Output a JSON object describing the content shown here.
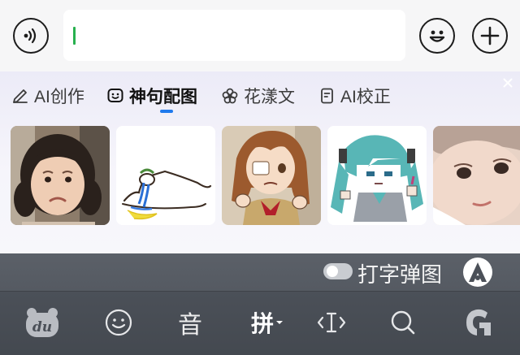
{
  "input_bar": {
    "voice_icon": "voice-wave-icon",
    "emoji_icon": "smiley-icon",
    "plus_icon": "plus-icon",
    "text_value": ""
  },
  "panel": {
    "tabs": [
      {
        "label": "AI创作",
        "icon": "pen-sparkle-icon",
        "active": false
      },
      {
        "label": "神句配图",
        "icon": "smile-bubble-icon",
        "active": true
      },
      {
        "label": "花漾文",
        "icon": "flower-icon",
        "active": false
      },
      {
        "label": "AI校正",
        "icon": "check-doc-icon",
        "active": false
      }
    ],
    "close_icon": "close-icon",
    "stickers": [
      {
        "name": "crying-child-sticker"
      },
      {
        "name": "doodle-figure-sticker"
      },
      {
        "name": "anime-girl-brown-hair-sticker"
      },
      {
        "name": "hatsune-miku-pixel-sticker"
      },
      {
        "name": "baby-face-sticker"
      }
    ]
  },
  "keyboard": {
    "toggle_label": "打字弹图",
    "toggle_on": false,
    "skin_icon": "skin-a-icon",
    "bar": {
      "logo_text": "du",
      "emoji_icon": "smiley-icon",
      "voice_label": "音",
      "input_mode_label": "拼",
      "cursor_icon": "cursor-move-icon",
      "search_icon": "search-icon",
      "collapse_icon": "g-logo-icon"
    }
  },
  "colors": {
    "caret": "#27b04e",
    "tab_underline": "#1f7aed",
    "keyboard_bg": "#4b5058"
  }
}
